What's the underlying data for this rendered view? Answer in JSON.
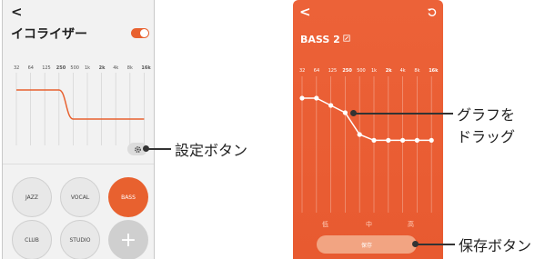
{
  "left": {
    "title": "イコライザー",
    "freq_labels": [
      "32",
      "64",
      "125",
      "250",
      "500",
      "1k",
      "2k",
      "4k",
      "8k",
      "16k"
    ],
    "eq_values": [
      1,
      1,
      1,
      1,
      -1,
      -1,
      -1,
      -1,
      -1,
      -1
    ],
    "toggle_on": true,
    "presets": [
      {
        "label": "JAZZ",
        "active": false
      },
      {
        "label": "VOCAL",
        "active": false
      },
      {
        "label": "BASS",
        "active": true
      },
      {
        "label": "CLUB",
        "active": false
      },
      {
        "label": "STUDIO",
        "active": false
      },
      {
        "label": "+",
        "active": false
      }
    ],
    "settings_icon": "gear-icon"
  },
  "right": {
    "title": "BASS 2",
    "freq_labels": [
      "32",
      "64",
      "125",
      "250",
      "500",
      "1k",
      "2k",
      "4k",
      "8k",
      "16k"
    ],
    "eq_values": [
      1,
      1,
      0.5,
      0,
      -1.5,
      -1.9,
      -1.9,
      -1.9,
      -1.9,
      -1.9
    ],
    "level_labels": [
      "低",
      "中",
      "高"
    ],
    "save_label": "保存",
    "reset_icon": "reset-icon",
    "edit_icon": "edit-icon"
  },
  "callouts": {
    "settings": "設定ボタン",
    "drag_line1": "グラフを",
    "drag_line2": "ドラッグ",
    "save": "保存ボタン"
  },
  "colors": {
    "accent": "#e8612f",
    "accent_light": "#f6b191"
  }
}
